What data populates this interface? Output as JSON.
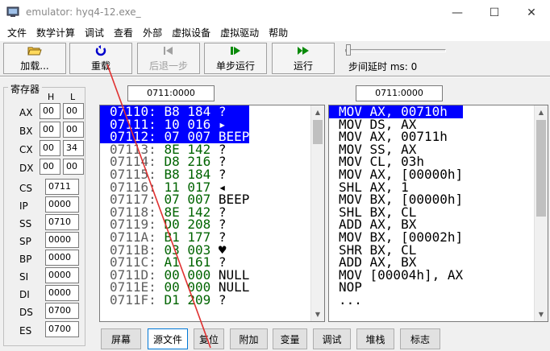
{
  "window": {
    "title": "emulator: hyq4-12.exe_",
    "minimize": "—",
    "maximize": "☐",
    "close": "✕"
  },
  "menu": [
    "文件",
    "数学计算",
    "调试",
    "查看",
    "外部",
    "虚拟设备",
    "虚拟驱动",
    "帮助"
  ],
  "toolbar": {
    "load": "加载...",
    "reload": "重载",
    "step_back": "后退一步",
    "single_step": "单步运行",
    "run": "运行",
    "step_delay": "步间延时 ms: 0"
  },
  "registers": {
    "title": "寄存器",
    "h": "H",
    "l": "L",
    "general": [
      {
        "name": "AX",
        "h": "00",
        "l": "00"
      },
      {
        "name": "BX",
        "h": "00",
        "l": "00"
      },
      {
        "name": "CX",
        "h": "00",
        "l": "34"
      },
      {
        "name": "DX",
        "h": "00",
        "l": "00"
      }
    ],
    "segment": [
      {
        "name": "CS",
        "value": "0711"
      },
      {
        "name": "IP",
        "value": "0000"
      },
      {
        "name": "SS",
        "value": "0710"
      },
      {
        "name": "SP",
        "value": "0000"
      },
      {
        "name": "BP",
        "value": "0000"
      },
      {
        "name": "SI",
        "value": "0000"
      },
      {
        "name": "DI",
        "value": "0000"
      },
      {
        "name": "DS",
        "value": "0700"
      },
      {
        "name": "ES",
        "value": "0700"
      }
    ]
  },
  "memory_address": "0711:0000",
  "disasm_address": "0711:0000",
  "memory_lines": [
    {
      "addr": "07110:",
      "hex": "B8",
      "dec": "184",
      "chr": "?",
      "sel": true
    },
    {
      "addr": "07111:",
      "hex": "10",
      "dec": "016",
      "chr": "▸",
      "sel": true
    },
    {
      "addr": "07112:",
      "hex": "07",
      "dec": "007",
      "chr": "BEEP",
      "sel": true
    },
    {
      "addr": "07113:",
      "hex": "8E",
      "dec": "142",
      "chr": "?",
      "sel": false
    },
    {
      "addr": "07114:",
      "hex": "D8",
      "dec": "216",
      "chr": "?",
      "sel": false
    },
    {
      "addr": "07115:",
      "hex": "B8",
      "dec": "184",
      "chr": "?",
      "sel": false
    },
    {
      "addr": "07116:",
      "hex": "11",
      "dec": "017",
      "chr": "◂",
      "sel": false
    },
    {
      "addr": "07117:",
      "hex": "07",
      "dec": "007",
      "chr": "BEEP",
      "sel": false
    },
    {
      "addr": "07118:",
      "hex": "8E",
      "dec": "142",
      "chr": "?",
      "sel": false
    },
    {
      "addr": "07119:",
      "hex": "D0",
      "dec": "208",
      "chr": "?",
      "sel": false
    },
    {
      "addr": "0711A:",
      "hex": "B1",
      "dec": "177",
      "chr": "?",
      "sel": false
    },
    {
      "addr": "0711B:",
      "hex": "03",
      "dec": "003",
      "chr": "♥",
      "sel": false
    },
    {
      "addr": "0711C:",
      "hex": "A1",
      "dec": "161",
      "chr": "?",
      "sel": false
    },
    {
      "addr": "0711D:",
      "hex": "00",
      "dec": "000",
      "chr": "NULL",
      "sel": false
    },
    {
      "addr": "0711E:",
      "hex": "00",
      "dec": "000",
      "chr": "NULL",
      "sel": false
    },
    {
      "addr": "0711F:",
      "hex": "D1",
      "dec": "209",
      "chr": "?",
      "sel": false
    }
  ],
  "disasm_lines": [
    {
      "text": "MOV AX, 00710h",
      "sel": true
    },
    {
      "text": "MOV DS, AX",
      "sel": false
    },
    {
      "text": "MOV AX, 00711h",
      "sel": false
    },
    {
      "text": "MOV SS, AX",
      "sel": false
    },
    {
      "text": "MOV CL, 03h",
      "sel": false
    },
    {
      "text": "MOV AX, [00000h]",
      "sel": false
    },
    {
      "text": "SHL AX, 1",
      "sel": false
    },
    {
      "text": "MOV BX, [00000h]",
      "sel": false
    },
    {
      "text": "SHL BX, CL",
      "sel": false
    },
    {
      "text": "ADD AX, BX",
      "sel": false
    },
    {
      "text": "MOV BX, [00002h]",
      "sel": false
    },
    {
      "text": "SHR BX, CL",
      "sel": false
    },
    {
      "text": "ADD AX, BX",
      "sel": false
    },
    {
      "text": "MOV [00004h], AX",
      "sel": false
    },
    {
      "text": "NOP",
      "sel": false
    },
    {
      "text": "...",
      "sel": false
    }
  ],
  "bottom_tabs": [
    "屏幕",
    "源文件",
    "复位",
    "附加",
    "变量",
    "调试",
    "堆栈",
    "标志"
  ],
  "colors": {
    "selection": "#0000ff",
    "hex_bytes": "#006400",
    "annotation_line": "#e03030"
  }
}
